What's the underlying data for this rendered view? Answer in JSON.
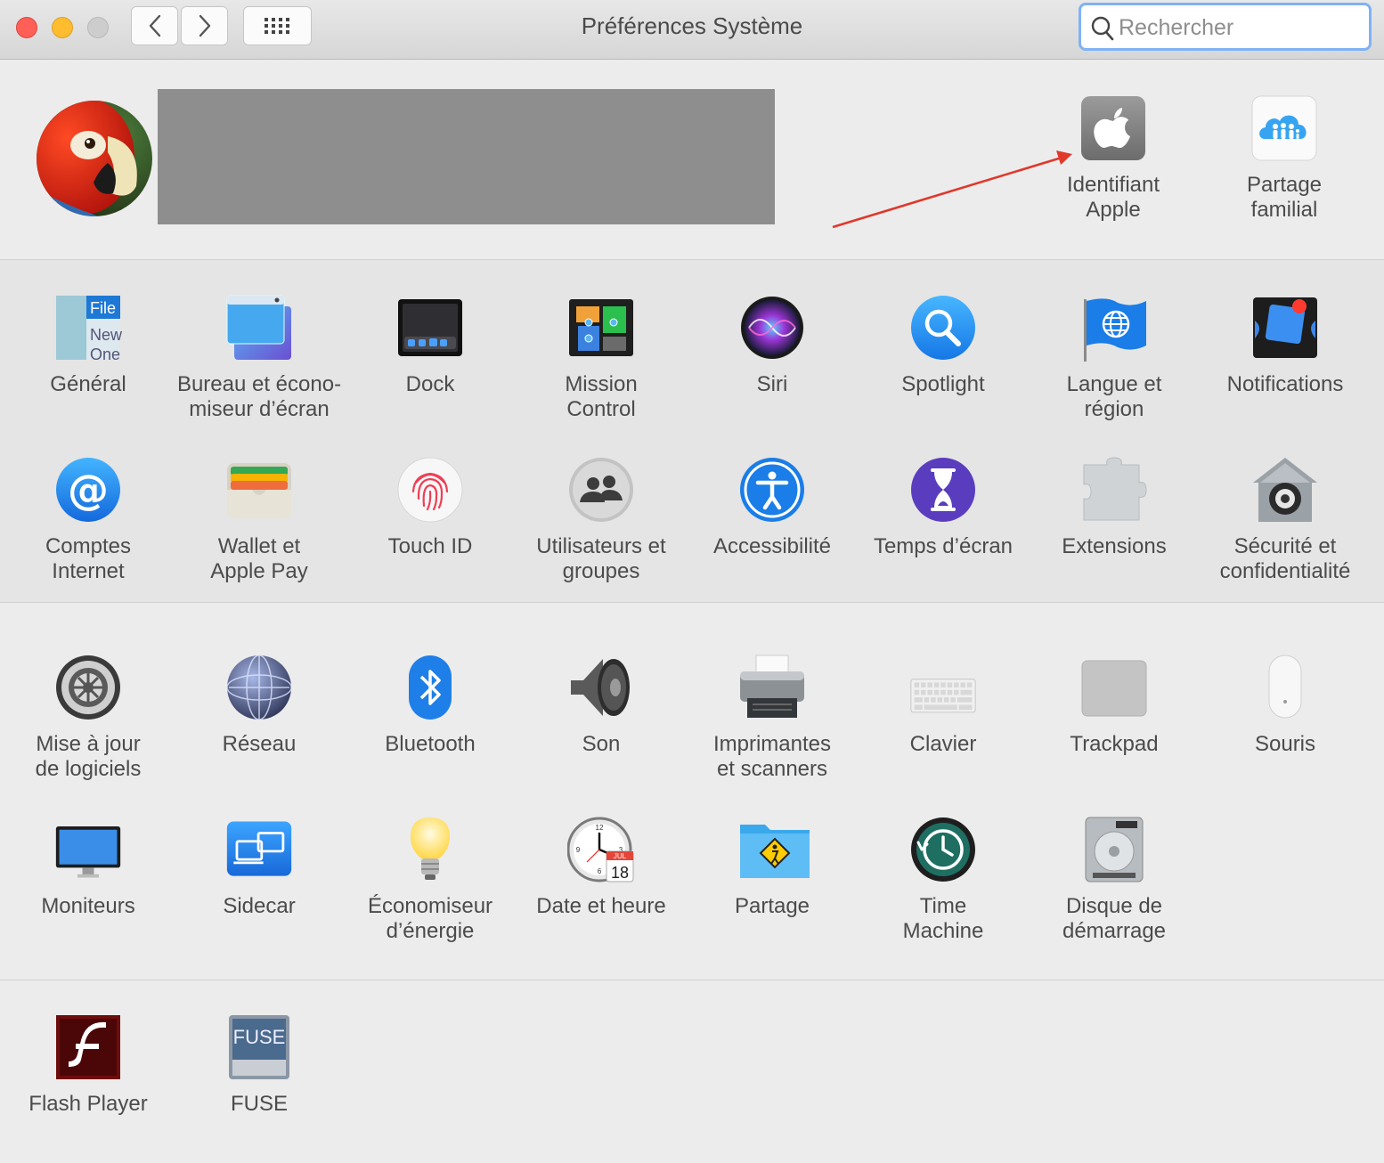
{
  "window": {
    "title": "Préférences Système",
    "search_placeholder": "Rechercher"
  },
  "apple_account": [
    {
      "label": "Identifiant\nApple",
      "icon": "apple-id-icon"
    },
    {
      "label": "Partage\nfamilial",
      "icon": "family-sharing-icon"
    }
  ],
  "row1": [
    {
      "label": "Général",
      "icon": "general-icon"
    },
    {
      "label": "Bureau et écono-\nmiseur d’écran",
      "icon": "desktop-screensaver-icon"
    },
    {
      "label": "Dock",
      "icon": "dock-icon"
    },
    {
      "label": "Mission\nControl",
      "icon": "mission-control-icon"
    },
    {
      "label": "Siri",
      "icon": "siri-icon"
    },
    {
      "label": "Spotlight",
      "icon": "spotlight-icon"
    },
    {
      "label": "Langue et\nrégion",
      "icon": "language-region-icon"
    },
    {
      "label": "Notifications",
      "icon": "notifications-icon"
    }
  ],
  "row2": [
    {
      "label": "Comptes\nInternet",
      "icon": "internet-accounts-icon"
    },
    {
      "label": "Wallet et\nApple Pay",
      "icon": "wallet-icon"
    },
    {
      "label": "Touch ID",
      "icon": "touch-id-icon"
    },
    {
      "label": "Utilisateurs et\ngroupes",
      "icon": "users-groups-icon"
    },
    {
      "label": "Accessibilité",
      "icon": "accessibility-icon"
    },
    {
      "label": "Temps d’écran",
      "icon": "screen-time-icon"
    },
    {
      "label": "Extensions",
      "icon": "extensions-icon"
    },
    {
      "label": "Sécurité et\nconfidentialité",
      "icon": "security-privacy-icon"
    }
  ],
  "row3": [
    {
      "label": "Mise à jour\nde logiciels",
      "icon": "software-update-icon"
    },
    {
      "label": "Réseau",
      "icon": "network-icon"
    },
    {
      "label": "Bluetooth",
      "icon": "bluetooth-icon"
    },
    {
      "label": "Son",
      "icon": "sound-icon"
    },
    {
      "label": "Imprimantes\net scanners",
      "icon": "printers-scanners-icon"
    },
    {
      "label": "Clavier",
      "icon": "keyboard-icon"
    },
    {
      "label": "Trackpad",
      "icon": "trackpad-icon"
    },
    {
      "label": "Souris",
      "icon": "mouse-icon"
    }
  ],
  "row4": [
    {
      "label": "Moniteurs",
      "icon": "displays-icon"
    },
    {
      "label": "Sidecar",
      "icon": "sidecar-icon"
    },
    {
      "label": "Économiseur\nd’énergie",
      "icon": "energy-saver-icon"
    },
    {
      "label": "Date et heure",
      "icon": "date-time-icon"
    },
    {
      "label": "Partage",
      "icon": "sharing-icon"
    },
    {
      "label": "Time\nMachine",
      "icon": "time-machine-icon"
    },
    {
      "label": "Disque de\ndémarrage",
      "icon": "startup-disk-icon"
    }
  ],
  "row5": [
    {
      "label": "Flash Player",
      "icon": "flash-player-icon"
    },
    {
      "label": "FUSE",
      "icon": "fuse-icon"
    }
  ],
  "icon_text": {
    "general": [
      "File",
      "New",
      "One"
    ],
    "calendar_month": "JUL",
    "calendar_day": "18",
    "fuse": "FUSE"
  },
  "colors": {
    "arrow": "#e0382c",
    "search_focus": "#7fb2f5"
  }
}
